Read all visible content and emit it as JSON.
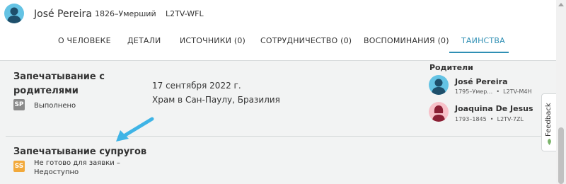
{
  "person": {
    "name": "José Pereira",
    "lifespan": "1826–Умерший",
    "pid": "L2TV-WFL"
  },
  "tabs": [
    {
      "label": "О ЧЕЛОВЕКЕ",
      "active": false
    },
    {
      "label": "ДЕТАЛИ",
      "active": false
    },
    {
      "label": "ИСТОЧНИКИ (0)",
      "active": false
    },
    {
      "label": "СОТРУДНИЧЕСТВО (0)",
      "active": false
    },
    {
      "label": "ВОСПОМИНАНИЯ (0)",
      "active": false
    },
    {
      "label": "ТАИНСТВА",
      "active": true
    }
  ],
  "ordinances": [
    {
      "title_line1": "Запечатывание с",
      "title_line2": "родителями",
      "badge": "SP",
      "badge_color": "#8a8a8a",
      "status_line1": "Выполнено",
      "status_line2": "",
      "date": "17 сентября 2022 г.",
      "place": "Храм в Сан-Паулу, Бразилия"
    },
    {
      "title_line1": "Запечатывание супругов",
      "title_line2": "",
      "badge": "SS",
      "badge_color": "#f2a93b",
      "status_line1": "Не готово для заявки –",
      "status_line2": "Недоступно"
    }
  ],
  "parents": {
    "heading": "Родители",
    "list": [
      {
        "name": "José Pereira",
        "years": "1795–Умер…",
        "pid": "L2TV-M4H",
        "avatar_color": "#64c3e4"
      },
      {
        "name": "Joaquina De Jesus",
        "years": "1793–1845",
        "pid": "L2TV-7ZL",
        "avatar_color": "#f7c1c9"
      }
    ]
  },
  "feedback": {
    "label": "Feedback"
  },
  "colors": {
    "accent": "#2f8fb4",
    "arrow": "#3fb4e6"
  }
}
